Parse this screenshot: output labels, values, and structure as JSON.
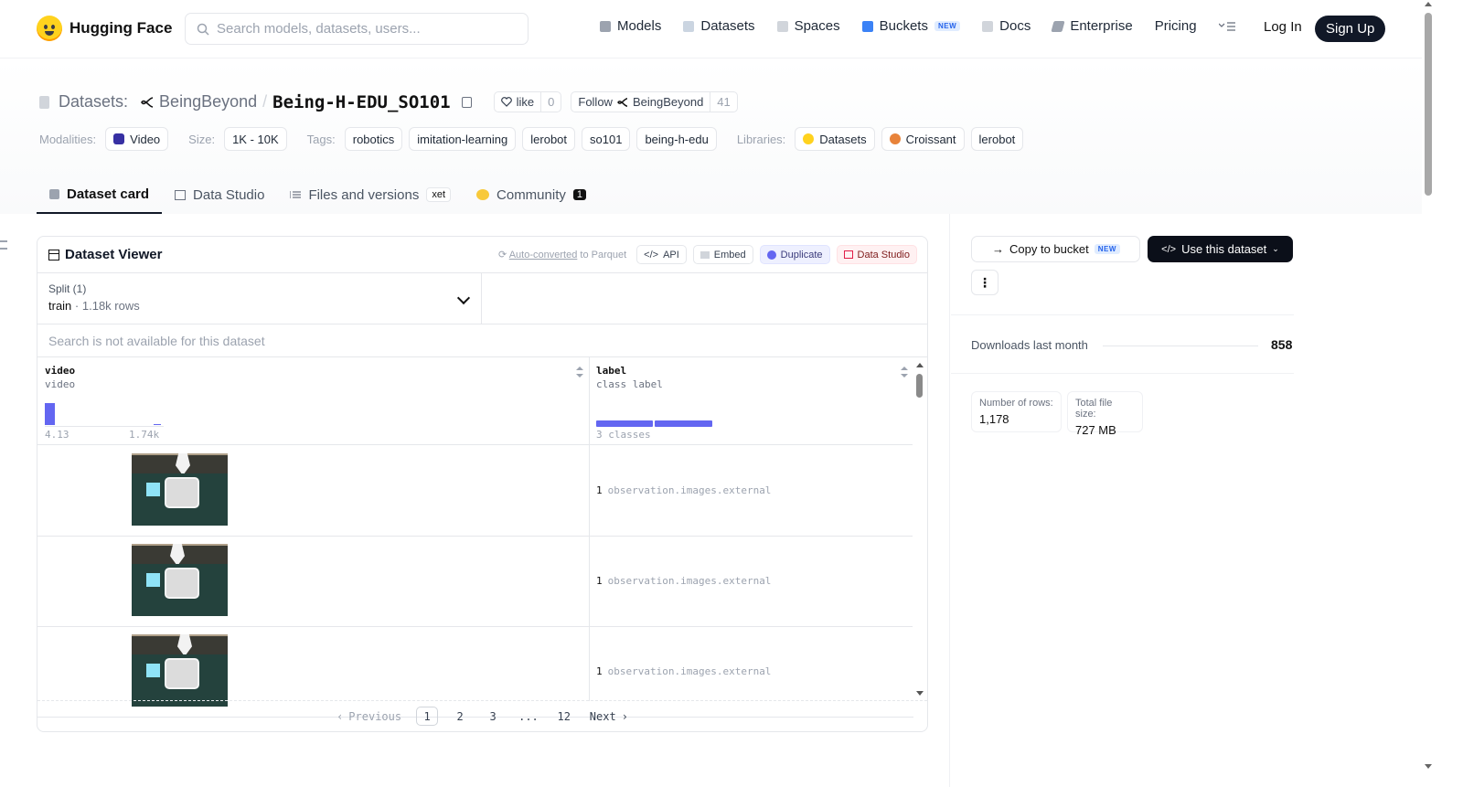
{
  "brand": {
    "name": "Hugging Face",
    "logo_icon": "hugging-face-emoji"
  },
  "search": {
    "placeholder": "Search models, datasets, users..."
  },
  "nav": {
    "items": [
      {
        "label": "Models",
        "icon": "cube-icon"
      },
      {
        "label": "Datasets",
        "icon": "database-icon"
      },
      {
        "label": "Spaces",
        "icon": "grid-icon"
      },
      {
        "label": "Buckets",
        "icon": "bucket-icon",
        "badge": "NEW"
      },
      {
        "label": "Docs",
        "icon": "book-icon"
      },
      {
        "label": "Enterprise",
        "icon": "enterprise-icon"
      },
      {
        "label": "Pricing"
      }
    ],
    "login": "Log In",
    "signup": "Sign Up"
  },
  "repo": {
    "type_label": "Datasets:",
    "owner": "BeingBeyond",
    "name": "Being-H-EDU_SO101",
    "like_label": "like",
    "like_count": "0",
    "follow_label": "Follow",
    "follow_owner": "BeingBeyond",
    "follow_count": "41"
  },
  "tags": {
    "modalities_label": "Modalities:",
    "modality": "Video",
    "size_label": "Size:",
    "size": "1K - 10K",
    "tags_label": "Tags:",
    "tag_list": [
      "robotics",
      "imitation-learning",
      "lerobot",
      "so101",
      "being-h-edu"
    ],
    "libraries_label": "Libraries:",
    "libraries": [
      "Datasets",
      "Croissant",
      "lerobot"
    ]
  },
  "tabs": [
    {
      "label": "Dataset card"
    },
    {
      "label": "Data Studio"
    },
    {
      "label": "Files and versions",
      "badge": "xet"
    },
    {
      "label": "Community",
      "count": "1"
    }
  ],
  "viewer": {
    "title": "Dataset Viewer",
    "auto_converted": "Auto-converted",
    "auto_converted_suffix": " to Parquet",
    "actions": {
      "api": "API",
      "embed": "Embed",
      "duplicate": "Duplicate",
      "studio": "Data Studio"
    },
    "split_title": "Split (1)",
    "split_name": "train",
    "split_rows": "1.18k rows",
    "search_na": "Search is not available for this dataset",
    "columns": [
      {
        "name": "video",
        "type": "video",
        "axis_min": "4.13",
        "axis_max": "1.74k"
      },
      {
        "name": "label",
        "type": "class label",
        "axis_note": "3 classes"
      }
    ],
    "rows": [
      {
        "label_num": "1",
        "label_text": "observation.images.external"
      },
      {
        "label_num": "1",
        "label_text": "observation.images.external"
      },
      {
        "label_num": "1",
        "label_text": "observation.images.external"
      }
    ],
    "pager": {
      "prev": "Previous",
      "pages": [
        "1",
        "2",
        "3",
        "...",
        "12"
      ],
      "next": "Next",
      "current": "1"
    }
  },
  "sidebar": {
    "copy_bucket": "Copy to bucket",
    "copy_bucket_badge": "NEW",
    "use_dataset": "Use this dataset",
    "downloads_label": "Downloads last month",
    "downloads_value": "858",
    "rows_label": "Number of rows:",
    "rows_value": "1,178",
    "size_label": "Total file size:",
    "size_value": "727 MB"
  },
  "colors": {
    "accent": "#6366f1",
    "dark_button": "#0b0f19",
    "brand_yellow": "#ffd21e"
  }
}
